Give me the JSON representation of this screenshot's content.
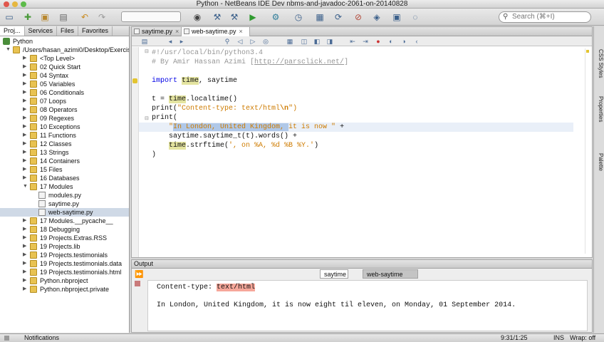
{
  "window": {
    "title": "Python - NetBeans IDE Dev nbms-and-javadoc-2061-on-20140828"
  },
  "toolbar": {
    "search_placeholder": "Search (⌘+I)"
  },
  "left_panel": {
    "tabs": [
      "Proj...",
      "Services",
      "Files",
      "Favorites"
    ],
    "root": "Python",
    "path": "/Users/hasan_azimi0/Desktop/Exercises",
    "items": [
      "<Top Level>",
      "02 Quick Start",
      "04 Syntax",
      "05 Variables",
      "06 Conditionals",
      "07 Loops",
      "08 Operators",
      "09 Regexes",
      "10 Exceptions",
      "11 Functions",
      "12 Classes",
      "13 Strings",
      "14 Containers",
      "15 Files",
      "16 Databases",
      "17 Modules"
    ],
    "module_files": [
      "modules.py",
      "saytime.py",
      "web-saytime.py"
    ],
    "items_after": [
      "17 Modules.__pycache__",
      "18 Debugging",
      "19 Projects.Extras.RSS",
      "19 Projects.lib",
      "19 Projects.testimonials",
      "19 Projects.testimonials.data",
      "19 Projects.testimonials.html",
      "Python.nbproject",
      "Python.nbproject.private"
    ]
  },
  "editor": {
    "tabs": [
      "saytime.py",
      "web-saytime.py"
    ],
    "code": {
      "l1": "#!/usr/local/bin/python3.4",
      "l2a": "# By Amir Hassan Azimi [",
      "l2b": "http://parsclick.net/",
      "l2c": "]",
      "l4a": "import ",
      "l4b": "time",
      "l4c": ", saytime",
      "l6a": "t = ",
      "l6b": "time",
      "l6c": ".localtime()",
      "l7a": "print(",
      "l7b": "\"Content-type: text/html",
      "l7c": "\\n",
      "l7d": "\")",
      "l8": "print(",
      "l9a": "\"",
      "l9b": "In London, United Kingdom, ",
      "l9c": "it is now \"",
      "l9d": " +",
      "l10": "saytime.saytime_t(t).words() +",
      "l11a": "time",
      "l11b": ".strftime(",
      "l11c": "', on %A, %d %B %Y.'",
      "l11d": ")",
      "l12": ")"
    }
  },
  "output": {
    "title": "Output",
    "tabs": [
      "saytime",
      "web-saytime"
    ],
    "line1_label": "Content-type: ",
    "line1_value": "text/html",
    "line2": "In London, United Kingdom, it is now eight til eleven, on Monday, 01 September 2014."
  },
  "right_bar": [
    "CSS Styles",
    "Properties",
    "Palette"
  ],
  "status": {
    "notifications": "Notifications",
    "position": "9:31/1:25",
    "mode": "INS",
    "wrap": "Wrap: off"
  },
  "colors": {
    "selection": "#cfd9e6",
    "error_highlight": "#f6a79a",
    "keyword": "#0000e6",
    "comment": "#969696",
    "string": "#ce7b00"
  }
}
